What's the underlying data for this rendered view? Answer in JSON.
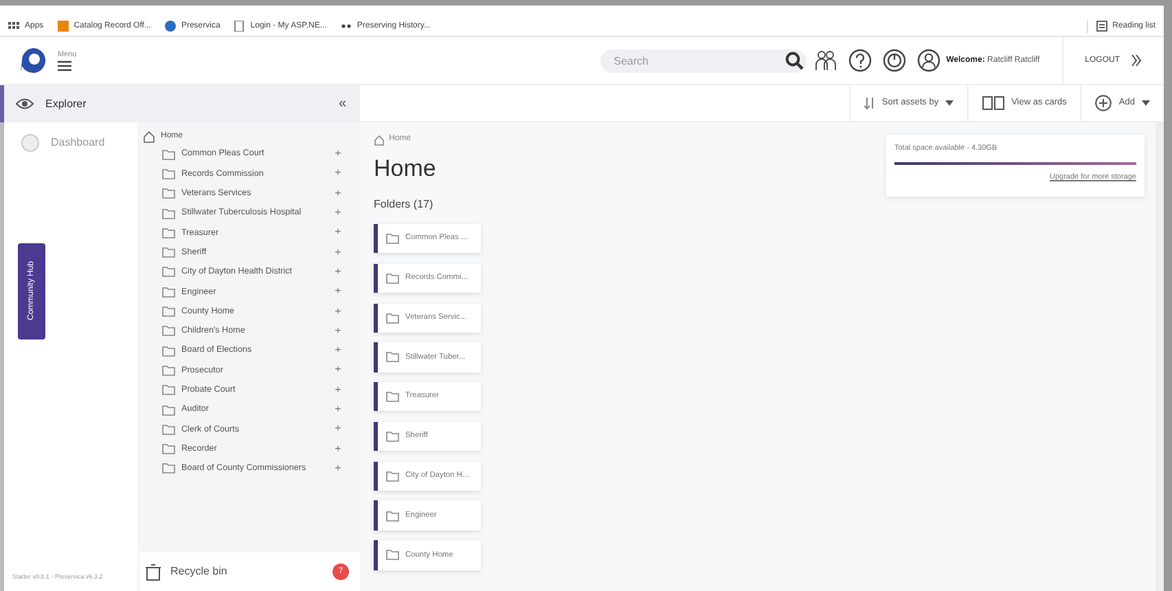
{
  "browser": {
    "bookmarks": [
      {
        "label": "Apps"
      },
      {
        "label": "Catalog Record Off..."
      },
      {
        "label": "Preservica"
      },
      {
        "label": "Login - My ASP.NE..."
      },
      {
        "label": "Preserving History..."
      }
    ],
    "reading_list": "Reading list"
  },
  "header": {
    "menu_label": "Menu",
    "search": {
      "placeholder": "Search"
    },
    "welcome_label": "Welcome:",
    "user": "Ratcliff Ratcliff",
    "logout": "LOGOUT"
  },
  "sidebar": {
    "items": [
      {
        "label": "Explorer",
        "selected": true
      },
      {
        "label": "Dashboard",
        "selected": false
      }
    ],
    "collapse": "«",
    "community_tab": "Community Hub",
    "version": "Starter v0.8.1 - Preservica v6.3.2"
  },
  "tree": {
    "root": "Home",
    "items": [
      {
        "label": "Common Pleas Court",
        "expand": "+"
      },
      {
        "label": "Records Commission",
        "expand": "+"
      },
      {
        "label": "Veterans Services",
        "expand": "+"
      },
      {
        "label": "Stillwater Tuberculosis Hospital",
        "expand": "+"
      },
      {
        "label": "Treasurer",
        "expand": "+"
      },
      {
        "label": "Sheriff",
        "expand": "+"
      },
      {
        "label": "City of Dayton Health District",
        "expand": "+"
      },
      {
        "label": "Engineer",
        "expand": "+"
      },
      {
        "label": "County Home",
        "expand": "+"
      },
      {
        "label": "Children's Home",
        "expand": "+"
      },
      {
        "label": "Board of Elections",
        "expand": "+"
      },
      {
        "label": "Prosecutor",
        "expand": "+"
      },
      {
        "label": "Probate Court",
        "expand": "+"
      },
      {
        "label": "Auditor",
        "expand": "+"
      },
      {
        "label": "Clerk of Courts",
        "expand": "+"
      },
      {
        "label": "Recorder",
        "expand": "+"
      },
      {
        "label": "Board of County Commissioners",
        "expand": "+"
      }
    ],
    "recycle_bin": {
      "label": "Recycle bin",
      "badge": "7"
    }
  },
  "toolbar": {
    "sort": "Sort assets by",
    "view": "View as cards",
    "add": "Add"
  },
  "main": {
    "breadcrumb": "Home",
    "title": "Home",
    "folders_heading": "Folders (17)",
    "folders": [
      "Common Pleas ...",
      "Records Commi...",
      "Veterans Servic...",
      "Stillwater Tuber...",
      "Treasurer",
      "Sheriff",
      "City of Dayton H...",
      "Engineer",
      "County Home"
    ]
  },
  "storage": {
    "label": "Total space available - 4.30GB",
    "level": 1,
    "link": "Upgrade for more storage"
  }
}
